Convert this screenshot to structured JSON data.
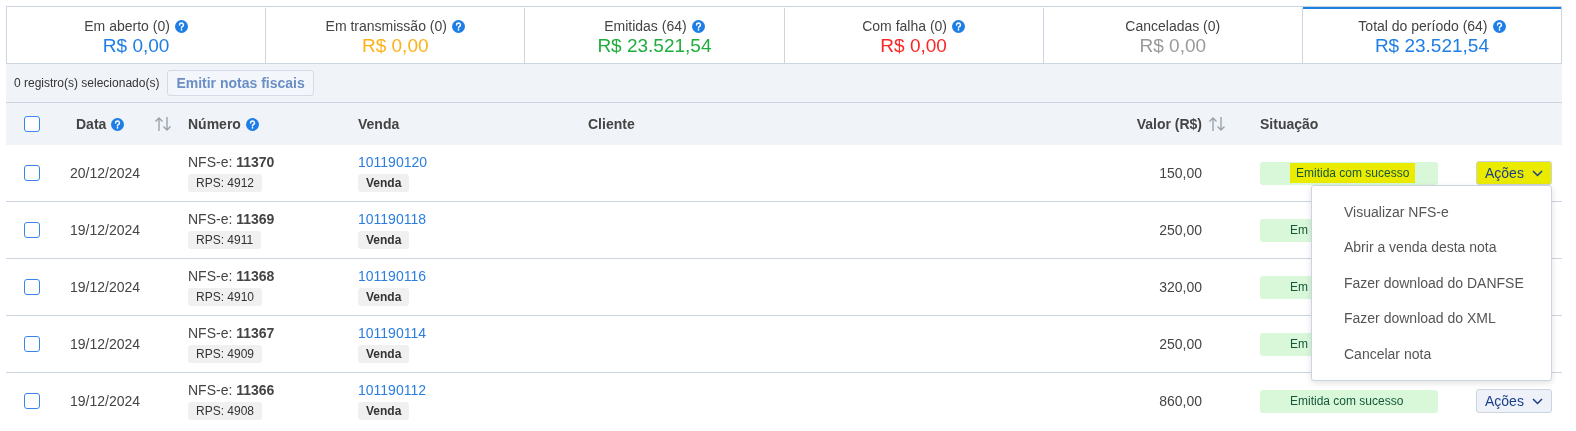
{
  "summary_cards": [
    {
      "label": "Em aberto (0)",
      "value": "R$ 0,00",
      "color": "#1e7ee6",
      "help": true,
      "selected": false
    },
    {
      "label": "Em transmissão (0)",
      "value": "R$ 0,00",
      "color": "#fcb217",
      "help": true,
      "selected": false
    },
    {
      "label": "Emitidas (64)",
      "value": "R$ 23.521,54",
      "color": "#1fae3c",
      "help": true,
      "selected": false
    },
    {
      "label": "Com falha (0)",
      "value": "R$ 0,00",
      "color": "#fb2626",
      "help": true,
      "selected": false
    },
    {
      "label": "Canceladas (0)",
      "value": "R$ 0,00",
      "color": "#9a9a9a",
      "help": false,
      "selected": false
    },
    {
      "label": "Total do período (64)",
      "value": "R$ 23.521,54",
      "color": "#1e7ee6",
      "help": true,
      "selected": true
    }
  ],
  "toolbar": {
    "selection_text": "0 registro(s) selecionado(s)",
    "emit_button": "Emitir notas fiscais"
  },
  "table": {
    "select_all": {
      "checked": false
    },
    "columns": [
      {
        "label": "Data",
        "help": true,
        "sortable": true
      },
      {
        "label": "Número",
        "help": true,
        "sortable": false
      },
      {
        "label": "Venda",
        "help": false,
        "sortable": false
      },
      {
        "label": "Cliente",
        "help": false,
        "sortable": false
      },
      {
        "label": "Valor (R$)",
        "help": false,
        "sortable": true
      },
      {
        "label": "Situação",
        "help": false,
        "sortable": false
      }
    ],
    "rows": [
      {
        "checked": false,
        "date": "20/12/2024",
        "number": "NFS-e: **11370**",
        "rps": "RPS: 4912",
        "sale_id": "101190120",
        "sale_tag": "Venda",
        "value": "150,00",
        "status": "Emitida com sucesso",
        "actions": "Ações",
        "highlighted": true,
        "menu_open": true
      },
      {
        "checked": false,
        "date": "19/12/2024",
        "number": "NFS-e: **11369**",
        "rps": "RPS: 4911",
        "sale_id": "101190118",
        "sale_tag": "Venda",
        "value": "250,00",
        "status": "Em",
        "highlighted": false,
        "menu_open": false
      },
      {
        "checked": false,
        "date": "19/12/2024",
        "number": "NFS-e: **11368**",
        "rps": "RPS: 4910",
        "sale_id": "101190116",
        "sale_tag": "Venda",
        "value": "320,00",
        "status": "Em",
        "highlighted": false,
        "menu_open": false
      },
      {
        "checked": false,
        "date": "19/12/2024",
        "number": "NFS-e: **11367**",
        "rps": "RPS: 4909",
        "sale_id": "101190114",
        "sale_tag": "Venda",
        "value": "250,00",
        "status": "Em",
        "highlighted": false,
        "menu_open": false
      },
      {
        "checked": false,
        "date": "19/12/2024",
        "number": "NFS-e: **11366**",
        "rps": "RPS: 4908",
        "sale_id": "101190112",
        "sale_tag": "Venda",
        "value": "860,00",
        "status": "Emitida com sucesso",
        "actions": "Ações",
        "highlighted": false,
        "menu_open": false
      }
    ]
  },
  "actions_menu": {
    "items": [
      "Visualizar NFS-e",
      "Abrir a venda desta nota",
      "Fazer download do DANFSE",
      "Fazer download do XML",
      "Cancelar nota"
    ]
  }
}
